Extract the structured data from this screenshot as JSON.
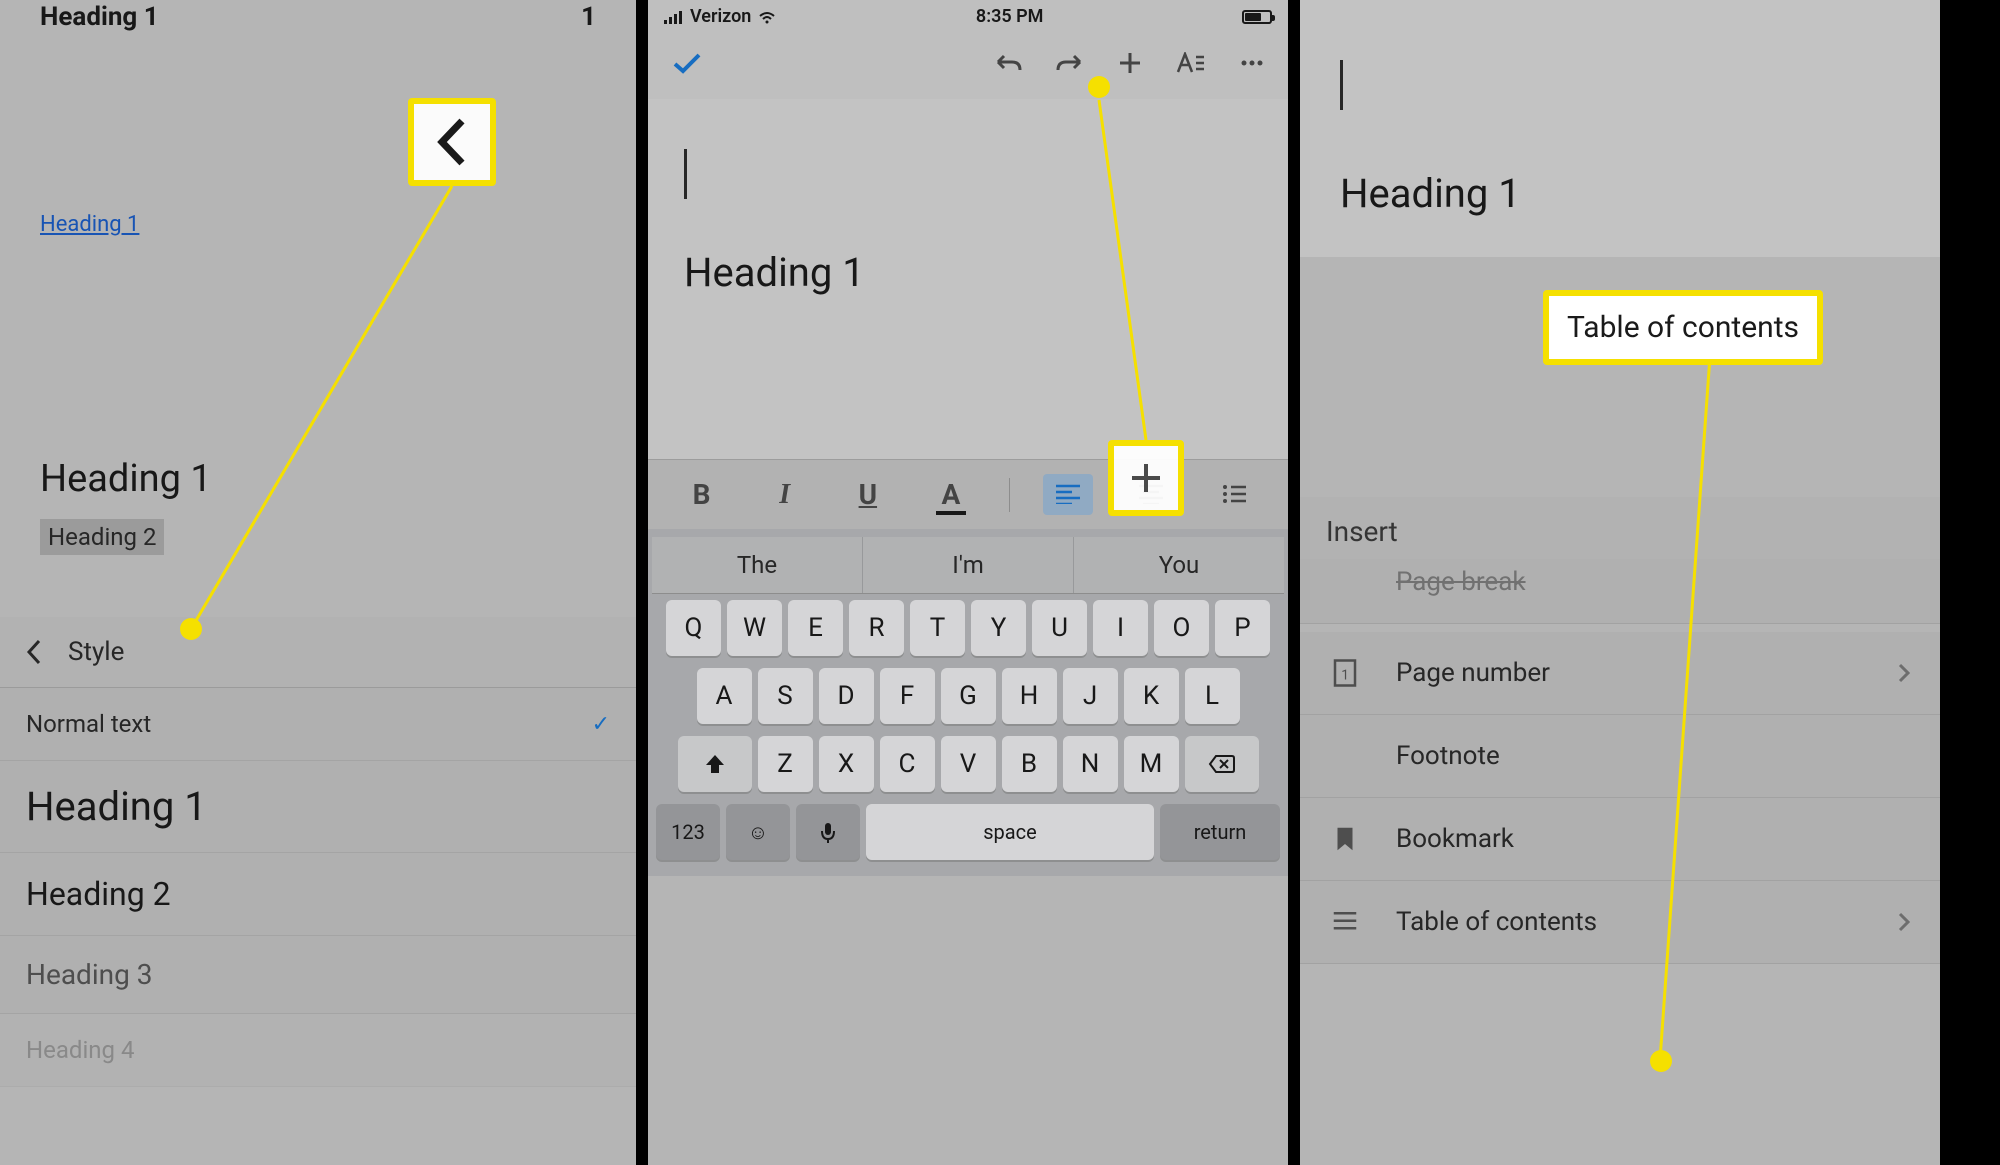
{
  "panel1": {
    "top_label": "Heading 1",
    "top_num": "1",
    "link_text": "Heading 1",
    "mid_h1": "Heading 1",
    "mid_h2": "Heading 2",
    "style_header": "Style",
    "styles": {
      "normal": "Normal text",
      "h1": "Heading 1",
      "h2": "Heading 2",
      "h3": "Heading 3",
      "h4": "Heading 4"
    }
  },
  "panel2": {
    "status": {
      "carrier": "Verizon",
      "time": "8:35 PM"
    },
    "doc_heading": "Heading 1",
    "suggestions": [
      "The",
      "I'm",
      "You"
    ],
    "keys_row1": [
      "Q",
      "W",
      "E",
      "R",
      "T",
      "Y",
      "U",
      "I",
      "O",
      "P"
    ],
    "keys_row2": [
      "A",
      "S",
      "D",
      "F",
      "G",
      "H",
      "J",
      "K",
      "L"
    ],
    "keys_row3": [
      "Z",
      "X",
      "C",
      "V",
      "B",
      "N",
      "M"
    ],
    "fn_key": "123",
    "space_key": "space",
    "return_key": "return"
  },
  "panel3": {
    "doc_heading": "Heading 1",
    "insert_header": "Insert",
    "items": {
      "pagebreak_cut": "Page break",
      "pagenum": "Page number",
      "footnote": "Footnote",
      "bookmark": "Bookmark",
      "toc": "Table of contents"
    }
  },
  "highlights": {
    "toc_label": "Table of contents"
  }
}
